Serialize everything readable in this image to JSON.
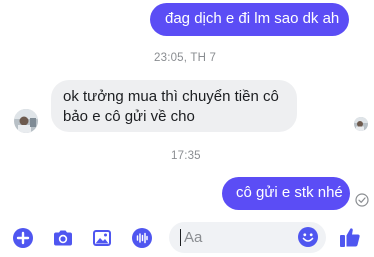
{
  "messages": {
    "sent_1": "đag dịch e đi lm sao dk ah",
    "received_1_line_1": "ok tưởng mua thì chuyển tiền cô",
    "received_1_line_2": "bảo e cô gửi về cho",
    "sent_2": "cô gửi e stk nhé"
  },
  "timestamps": {
    "first": "23:05, TH 7",
    "second": "17:35"
  },
  "composer": {
    "placeholder": "Aa",
    "tools": [
      "plus-icon",
      "camera-icon",
      "photo-icon",
      "microphone-icon"
    ],
    "emoji_icon": "smiley-icon",
    "like_icon": "thumbs-up-icon"
  },
  "colors": {
    "sent_bubble": "#5b4df5",
    "received_bubble": "#eeeff1",
    "accent": "#4f56f0",
    "timestamp": "#8a8d91"
  }
}
